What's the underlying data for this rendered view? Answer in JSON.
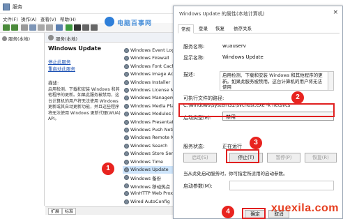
{
  "services_window": {
    "title": "服务",
    "menu": [
      "文件(F)",
      "操作(A)",
      "查看(V)",
      "帮助(H)"
    ],
    "tree_root": "服务(本地)",
    "header_label": "服务(本地)",
    "detail": {
      "title": "Windows Update",
      "stop_link": "停止此服务",
      "restart_link": "重启动此服务",
      "desc_label": "描述:",
      "description": "启用检测、下载和安装 Windows 和其他程序的更新。如果此服务被禁用，这台计算机的用户将无法使用 Windows 更新或其自动更新功能，并且这些程序将无法使用 Windows 更新代理(WUA) API。"
    },
    "services": [
      "Windows Event Log",
      "Windows Firewall",
      "Windows Font Cache",
      "Windows Image Acq",
      "Windows Installer",
      "Windows License M",
      "Windows Manageme",
      "Windows Media Pla",
      "Windows Modules I",
      "Windows Presentati",
      "Windows Push Notif",
      "Windows Remote M",
      "Windows Search",
      "Windows Store Serv",
      "Windows Time",
      "Windows Update",
      "Windows 备份",
      "Windows 移动热点",
      "WinHTTP Web Proxy",
      "Wired AutoConfig"
    ],
    "selected_service": "Windows Update",
    "bottom_tabs": [
      "扩展",
      "标准"
    ]
  },
  "logo_text": "电脑百事网",
  "dialog": {
    "title": "Windows Update 的属性(本地计算机)",
    "close": "×",
    "tabs": [
      "常规",
      "登录",
      "恢复",
      "依存关系"
    ],
    "active_tab": "常规",
    "service_name_label": "服务名称:",
    "service_name": "wuauserv",
    "display_name_label": "显示名称:",
    "display_name": "Windows Update",
    "desc_label": "描述:",
    "description": "启用检测、下载和安装 Windows 和其他程序的更新。如果此服务被禁用，这台计算机的用户将无法使用",
    "path_label": "可执行文件的路径:",
    "path": "C:\\windows\\system32\\svchost.exe -k netsvcs",
    "startup_label": "启动类型(E):",
    "startup_value": "禁用",
    "status_label": "服务状态:",
    "status_value": "正在运行",
    "buttons": {
      "start": "启动(S)",
      "stop": "停止(T)",
      "pause": "暂停(P)",
      "resume": "恢复(R)"
    },
    "hint": "当从此处启动服务时，你可指定所适用的启动参数。",
    "param_label": "启动参数(M):",
    "ok": "确定",
    "cancel": "取消"
  },
  "callouts": [
    "1",
    "2",
    "3",
    "4"
  ],
  "watermark": "xuexila.com",
  "colors": {
    "accent_red": "#e02020",
    "selection": "#cde4fb",
    "link": "#1a4fb3"
  }
}
